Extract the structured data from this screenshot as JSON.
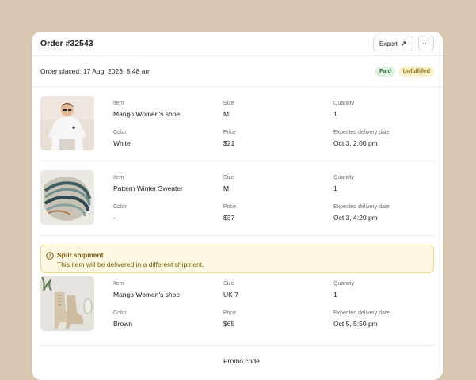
{
  "header": {
    "title": "Order #32543",
    "export_label": "Export",
    "more_label": "···"
  },
  "order": {
    "placed_text": "Order placed: 17 Aug, 2023, 5:48 am",
    "badges": {
      "paid": "Paid",
      "unfulfilled": "Unfulfilled"
    }
  },
  "labels": {
    "item": "Item",
    "size": "Size",
    "quantity": "Quantity",
    "color": "Color",
    "price": "Price",
    "delivery": "Expected delivery date"
  },
  "items": [
    {
      "name": "Mango Women's shoe",
      "size": "M",
      "quantity": "1",
      "color": "White",
      "price": "$21",
      "delivery": "Oct 3, 2:00 pm"
    },
    {
      "name": "Pattern Winter Sweater",
      "size": "M",
      "quantity": "1",
      "color": "-",
      "price": "$37",
      "delivery": "Oct 3, 4:20 pm"
    },
    {
      "name": "Mango Women's shoe",
      "size": "UK 7",
      "quantity": "1",
      "color": "Brown",
      "price": "$65",
      "delivery": "Oct 5, 5:50 pm"
    }
  ],
  "alert": {
    "title": "Split shipment",
    "description": "This item will be delivered in a different shipment."
  },
  "promo": {
    "label": "Promo code"
  },
  "colors": {
    "background": "#d9c7b2",
    "paid_badge": "#dff1e2",
    "unfulfilled_badge": "#fbf0c7",
    "alert_bg": "#fdf8e1"
  }
}
